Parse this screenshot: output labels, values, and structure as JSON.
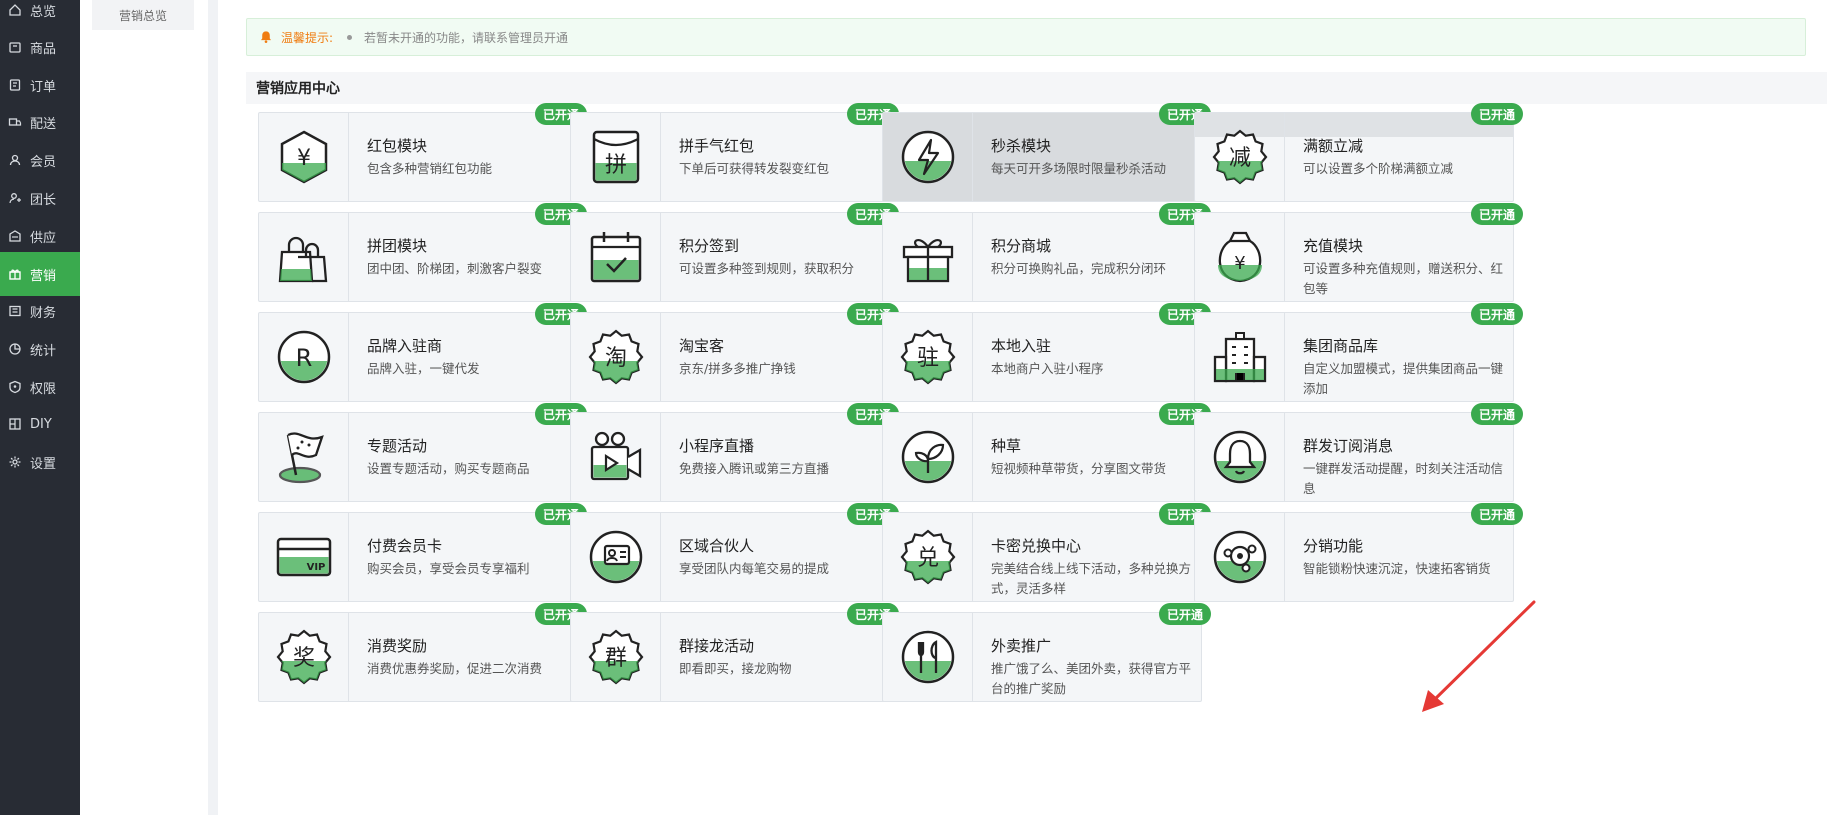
{
  "sidebar": {
    "items": [
      {
        "label": "总览",
        "icon": "home-icon",
        "active": false
      },
      {
        "label": "商品",
        "icon": "goods-icon",
        "active": false
      },
      {
        "label": "订单",
        "icon": "order-icon",
        "active": false
      },
      {
        "label": "配送",
        "icon": "delivery-icon",
        "active": false
      },
      {
        "label": "会员",
        "icon": "member-icon",
        "active": false
      },
      {
        "label": "团长",
        "icon": "leader-icon",
        "active": false
      },
      {
        "label": "供应",
        "icon": "supply-icon",
        "active": false
      },
      {
        "label": "营销",
        "icon": "marketing-icon",
        "active": true
      },
      {
        "label": "财务",
        "icon": "finance-icon",
        "active": false
      },
      {
        "label": "统计",
        "icon": "stats-icon",
        "active": false
      },
      {
        "label": "权限",
        "icon": "permission-icon",
        "active": false
      },
      {
        "label": "DIY",
        "icon": "diy-icon",
        "active": false
      },
      {
        "label": "设置",
        "icon": "settings-icon",
        "active": false
      }
    ],
    "active_color": "#3aaa4e"
  },
  "subnav": {
    "item": "营销总览"
  },
  "notice": {
    "title": "温馨提示:",
    "text": "若暂未开通的功能，请联系管理员开通"
  },
  "section": {
    "title": "营销应用中心"
  },
  "badge_label": "已开通",
  "cards": [
    {
      "title": "红包模块",
      "desc": "包含多种营销红包功能",
      "icon": "red-packet-icon"
    },
    {
      "title": "拼手气红包",
      "desc": "下单后可获得转发裂变红包",
      "icon": "lucky-packet-icon"
    },
    {
      "title": "秒杀模块",
      "desc": "每天可开多场限时限量秒杀活动",
      "icon": "flash-sale-icon"
    },
    {
      "title": "满额立减",
      "desc": "可以设置多个阶梯满额立减",
      "icon": "discount-icon"
    },
    {
      "title": "拼团模块",
      "desc": "团中团、阶梯团，刺激客户裂变",
      "icon": "group-buy-icon"
    },
    {
      "title": "积分签到",
      "desc": "可设置多种签到规则，获取积分",
      "icon": "checkin-icon"
    },
    {
      "title": "积分商城",
      "desc": "积分可换购礼品，完成积分闭环",
      "icon": "gift-icon"
    },
    {
      "title": "充值模块",
      "desc": "可设置多种充值规则，赠送积分、红包等",
      "icon": "recharge-icon"
    },
    {
      "title": "品牌入驻商",
      "desc": "品牌入驻，一键代发",
      "icon": "brand-icon"
    },
    {
      "title": "淘宝客",
      "desc": "京东/拼多多推广挣钱",
      "icon": "taobao-icon"
    },
    {
      "title": "本地入驻",
      "desc": "本地商户入驻小程序",
      "icon": "local-icon"
    },
    {
      "title": "集团商品库",
      "desc": "自定义加盟模式，提供集团商品一键添加",
      "icon": "building-icon"
    },
    {
      "title": "专题活动",
      "desc": "设置专题活动，购买专题商品",
      "icon": "flag-icon"
    },
    {
      "title": "小程序直播",
      "desc": "免费接入腾讯或第三方直播",
      "icon": "live-icon"
    },
    {
      "title": "种草",
      "desc": "短视频种草带货，分享图文带货",
      "icon": "sprout-icon"
    },
    {
      "title": "群发订阅消息",
      "desc": "一键群发活动提醒，时刻关注活动信息",
      "icon": "bell-icon"
    },
    {
      "title": "付费会员卡",
      "desc": "购买会员，享受会员专享福利",
      "icon": "vip-card-icon"
    },
    {
      "title": "区域合伙人",
      "desc": "享受团队内每笔交易的提成",
      "icon": "partner-icon"
    },
    {
      "title": "卡密兑换中心",
      "desc": "完美结合线上线下活动，多种兑换方式，灵活多样",
      "icon": "exchange-icon"
    },
    {
      "title": "分销功能",
      "desc": "智能锁粉快速沉淀，快速拓客销货",
      "icon": "distribution-icon"
    },
    {
      "title": "消费奖励",
      "desc": "消费优惠券奖励，促进二次消费",
      "icon": "reward-icon"
    },
    {
      "title": "群接龙活动",
      "desc": "即看即买，接龙购物",
      "icon": "solitaire-icon"
    },
    {
      "title": "外卖推广",
      "desc": "推广饿了么、美团外卖，获得官方平台的推广奖励",
      "icon": "takeout-icon"
    }
  ],
  "colors": {
    "accent": "#3aaa4e",
    "arrow": "#e53935",
    "notice_title": "#f07d12"
  }
}
